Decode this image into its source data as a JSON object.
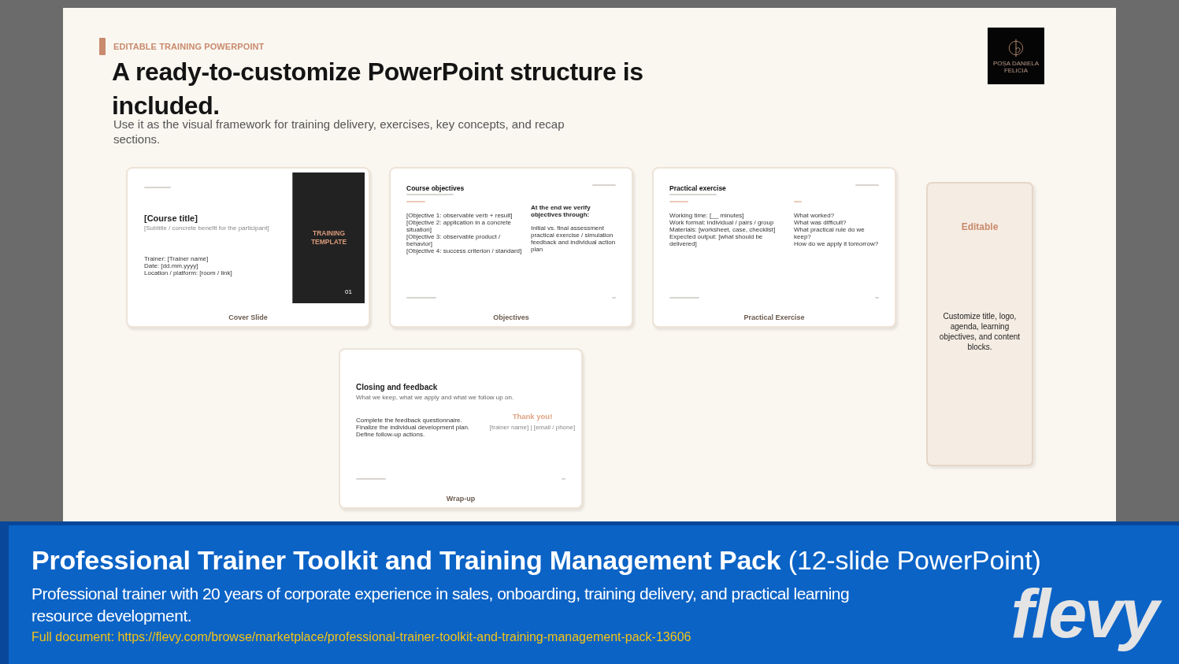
{
  "slide": {
    "eyebrow": "EDITABLE TRAINING POWERPOINT",
    "title": "A ready-to-customize PowerPoint structure is included.",
    "subtitle": "Use it as the visual framework for training delivery, exercises, key concepts, and recap sections.",
    "logo_text": "POȘA DANIELA FELICIA",
    "thumbnails": [
      {
        "kind": "cover",
        "label": "Cover Slide",
        "title": "[Course title]",
        "subtitle": "[Subtitle / concrete benefit for the participant]",
        "details": [
          "Trainer: [Trainer name]",
          "Date: [dd.mm.yyyy]",
          "Location / platform: [room / link]"
        ],
        "panel_title": "TRAINING TEMPLATE",
        "panel_number": "01"
      },
      {
        "kind": "two_column",
        "label": "Objectives",
        "title": "Course objectives",
        "left": [
          "[Objective 1: observable verb + result]",
          "[Objective 2: application in a concrete situation]",
          "[Objective 3: observable product / behavior]",
          "[Objective 4: success criterion / standard]"
        ],
        "right_heading": "At the end we verify objectives through:",
        "right": [
          "Initial vs. final assessment",
          "practical exercise / simulation",
          "feedback and individual action plan"
        ]
      },
      {
        "kind": "two_column",
        "label": "Practical Exercise",
        "title": "Practical exercise",
        "left": [
          "Working time: [__ minutes]",
          "Work format: individual / pairs / group",
          "Materials: [worksheet, case, checklist]",
          "Expected output: [what should be delivered]"
        ],
        "right": [
          "What worked?",
          "What was difficult?",
          "What practical rule do we keep?",
          "How do we apply it tomorrow?"
        ]
      },
      {
        "kind": "closing",
        "label": "Wrap-up",
        "title": "Closing and feedback",
        "subtitle": "What we keep, what we apply and what we follow up on.",
        "left": [
          "Complete the feedback questionnaire.",
          "Finalize the individual development plan.",
          "Define follow-up actions."
        ],
        "thanks": "Thank you!",
        "contact": "[trainer name] | [email / phone]"
      }
    ],
    "side_card": {
      "title": "Editable",
      "text": "Customize title, logo, agenda, learning objectives, and content blocks."
    }
  },
  "footer": {
    "title": "Professional Trainer Toolkit and Training Management Pack",
    "title_suffix": "(12-slide PowerPoint)",
    "description": "Professional trainer with 20 years of corporate experience in sales, onboarding, training delivery, and practical learning resource development.",
    "link_label": "Full document:",
    "link": "https://flevy.com/browse/marketplace/professional-trainer-toolkit-and-training-management-pack-13606",
    "brand": "flevy"
  }
}
